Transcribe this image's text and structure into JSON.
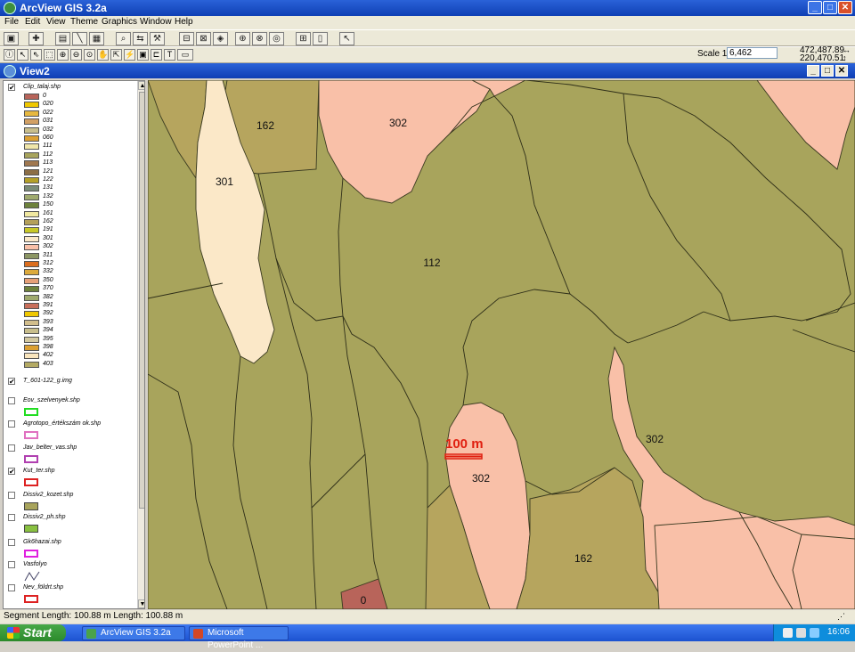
{
  "app": {
    "title": "ArcView GIS 3.2a"
  },
  "menu": [
    "File",
    "Edit",
    "View",
    "Theme",
    "Graphics",
    "Window",
    "Help"
  ],
  "scale": {
    "label": "Scale 1:",
    "value": "6,462"
  },
  "coords": {
    "x": "472,487.89",
    "y": "220,470.51",
    "arrows": "↔ ↕"
  },
  "view": {
    "title": "View2"
  },
  "toc": {
    "theme1": {
      "name": "Clip_talaj.shp",
      "checked": "✔"
    },
    "legend": [
      {
        "code": "0",
        "color": "#b8645a"
      },
      {
        "code": "020",
        "color": "#f0c800"
      },
      {
        "code": "022",
        "color": "#e6b840"
      },
      {
        "code": "031",
        "color": "#d2a064"
      },
      {
        "code": "032",
        "color": "#c8be8c"
      },
      {
        "code": "060",
        "color": "#dca032"
      },
      {
        "code": "111",
        "color": "#f0e6aa"
      },
      {
        "code": "112",
        "color": "#a8a45c"
      },
      {
        "code": "113",
        "color": "#a07850"
      },
      {
        "code": "121",
        "color": "#8c6e46"
      },
      {
        "code": "122",
        "color": "#b4a028"
      },
      {
        "code": "131",
        "color": "#7a8c78"
      },
      {
        "code": "132",
        "color": "#a0aa6e"
      },
      {
        "code": "150",
        "color": "#6e823c"
      },
      {
        "code": "161",
        "color": "#f0e8a0"
      },
      {
        "code": "162",
        "color": "#b4a05a"
      },
      {
        "code": "191",
        "color": "#c8c828"
      },
      {
        "code": "301",
        "color": "#fbe8c8"
      },
      {
        "code": "302",
        "color": "#f9c0a8"
      },
      {
        "code": "311",
        "color": "#8c9664"
      },
      {
        "code": "312",
        "color": "#dc6e1e"
      },
      {
        "code": "332",
        "color": "#dcaa3c"
      },
      {
        "code": "350",
        "color": "#e6a078"
      },
      {
        "code": "370",
        "color": "#6e823c"
      },
      {
        "code": "382",
        "color": "#a0aa6e"
      },
      {
        "code": "391",
        "color": "#c86e5a"
      },
      {
        "code": "392",
        "color": "#f0c800"
      },
      {
        "code": "393",
        "color": "#d2be8c"
      },
      {
        "code": "394",
        "color": "#c8be8c"
      },
      {
        "code": "395",
        "color": "#d2c8a0"
      },
      {
        "code": "398",
        "color": "#dca032"
      },
      {
        "code": "402",
        "color": "#fae6be"
      },
      {
        "code": "403",
        "color": "#b4aa64"
      }
    ],
    "themes": [
      {
        "name": "T_601-122_g.img",
        "checked": "✔",
        "sym": "none"
      },
      {
        "name": "Eov_szelvenyek.shp",
        "checked": "",
        "sym": "#22dd22"
      },
      {
        "name": "Agrotopo_értékszám ok.shp",
        "checked": "",
        "sym": "#e070c0"
      },
      {
        "name": "Jav_belter_vas.shp",
        "checked": "",
        "sym": "#b040b0"
      },
      {
        "name": "Kut_ter.shp",
        "checked": "✔",
        "sym": "#dd2222"
      },
      {
        "name": "Dissiv2_kozet.shp",
        "checked": "",
        "sym": "#a8a45c"
      },
      {
        "name": "Dissiv2_ph.shp",
        "checked": "",
        "sym": "#88c040"
      },
      {
        "name": "Gk6hazai.shp",
        "checked": "",
        "sym": "#e020e0"
      },
      {
        "name": "Vasfolyo",
        "checked": "",
        "sym": "line"
      },
      {
        "name": "Nev_földrt.shp",
        "checked": "",
        "sym": "#dd2222"
      }
    ]
  },
  "map": {
    "labels": [
      "162",
      "302",
      "301",
      "112",
      "302",
      "302",
      "162",
      "0"
    ],
    "scalebar": "100 m",
    "colors": {
      "c112": "#a8a45c",
      "c162": "#b6a55e",
      "c301": "#fbe8c8",
      "c302": "#f9c0a8",
      "c0": "#b8645a",
      "scalebar": "#e02010"
    }
  },
  "status": {
    "text": "Segment Length: 100.88 m  Length: 100.88 m"
  },
  "taskbar": {
    "start": "Start",
    "tasks": [
      "ArcView GIS 3.2a",
      "Microsoft PowerPoint ..."
    ],
    "clock": "16:06"
  }
}
